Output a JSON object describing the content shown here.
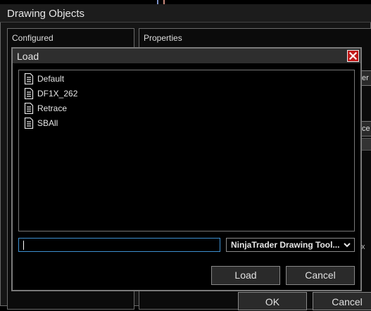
{
  "background_window": {
    "title": "Drawing Objects",
    "configured_label": "Configured",
    "properties_label": "Properties",
    "partial_button_1": "er",
    "partial_button_2": "ce",
    "partial_text": "x",
    "ok_label": "OK",
    "cancel_label": "Cancel"
  },
  "load_dialog": {
    "title": "Load",
    "files": [
      {
        "name": "Default",
        "icon": "document-icon"
      },
      {
        "name": "DF1X_262",
        "icon": "document-icon"
      },
      {
        "name": "Retrace",
        "icon": "document-icon"
      },
      {
        "name": "SBAll",
        "icon": "document-icon"
      }
    ],
    "filename_value": "",
    "filetype_selected": "NinjaTrader Drawing Tool...",
    "load_label": "Load",
    "cancel_label": "Cancel"
  },
  "colors": {
    "input_focus_border": "#3d8fd0",
    "close_button_bg": "#c01818"
  }
}
